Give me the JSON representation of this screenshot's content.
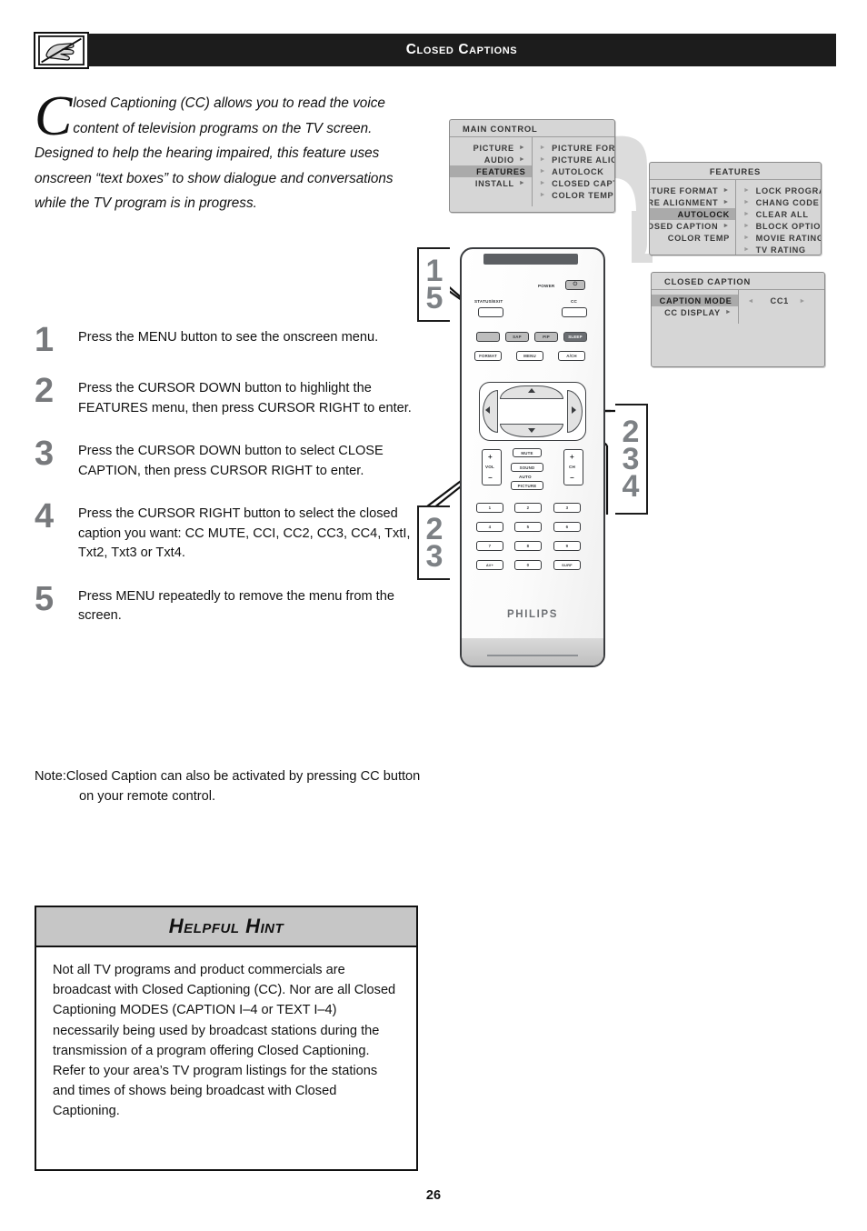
{
  "header": {
    "title": "Closed Captions",
    "icon": "hand-pointing-tv-crossed-icon"
  },
  "intro": {
    "dropcap": "C",
    "text": "losed Captioning (CC) allows you to read the voice content of television programs on the TV screen. Designed to help the hearing impaired, this feature uses onscreen “text boxes” to show dialogue and conversations while the TV program is in progress."
  },
  "steps": [
    {
      "num": "1",
      "text": "Press the MENU button to see the onscreen menu."
    },
    {
      "num": "2",
      "text": "Press the CURSOR DOWN button to highlight the FEATURES menu, then press CURSOR RIGHT to enter."
    },
    {
      "num": "3",
      "text": "Press the CURSOR DOWN button to select CLOSE CAPTION, then press CURSOR RIGHT to enter."
    },
    {
      "num": "4",
      "text": "Press the CURSOR RIGHT button to select the closed caption you want: CC MUTE, CCI, CC2, CC3, CC4, TxtI, Txt2, Txt3 or Txt4."
    },
    {
      "num": "5",
      "text": "Press MENU repeatedly to remove the menu from the screen."
    }
  ],
  "note": {
    "label": "Note:",
    "text": "Closed Caption can also be activated by pressing CC button on your remote control."
  },
  "hint": {
    "title": "Helpful Hint",
    "body": "Not all TV programs and product commercials are broadcast with Closed Captioning (CC). Nor are all Closed Captioning MODES (CAPTION I–4 or TEXT I–4) necessarily being used by broadcast stations during the transmission of a program offering Closed Captioning. Refer to your area’s TV program listings for the stations and times of shows being broadcast with Closed Captioning."
  },
  "page_number": "26",
  "osd": {
    "main_control": {
      "title": "MAIN CONTROL",
      "left_items": [
        {
          "label": "PICTURE",
          "arrow": true,
          "selected": false
        },
        {
          "label": "AUDIO",
          "arrow": true,
          "selected": false
        },
        {
          "label": "FEATURES",
          "arrow": false,
          "selected": true
        },
        {
          "label": "INSTALL",
          "arrow": true,
          "selected": false
        }
      ],
      "right_items": [
        "PICTURE FORMAT",
        "PICTURE ALIGNMENT",
        "AUTOLOCK",
        "CLOSED CAPTION",
        "COLOR TEMP"
      ]
    },
    "features": {
      "title": "FEATURES",
      "left_items": [
        {
          "label": "PICTURE FORMAT",
          "arrow": true,
          "selected": false
        },
        {
          "label": "PICTURE ALIGNMENT",
          "arrow": true,
          "selected": false
        },
        {
          "label": "AUTOLOCK",
          "arrow": false,
          "selected": true
        },
        {
          "label": "CLOSED CAPTION",
          "arrow": true,
          "selected": false
        },
        {
          "label": "COLOR TEMP",
          "arrow": false,
          "selected": false
        }
      ],
      "right_items": [
        "LOCK PROGRAM",
        "CHANG CODE",
        "CLEAR ALL",
        "BLOCK OPTION",
        "MOVIE RATING",
        "TV RATING"
      ]
    },
    "closed_caption": {
      "title": "CLOSED CAPTION",
      "left_items": [
        {
          "label": "CAPTION MODE",
          "arrow": false,
          "selected": true
        },
        {
          "label": "CC DISPLAY",
          "arrow": true,
          "selected": false
        }
      ],
      "value": "CC1",
      "left_arrow": "◄",
      "right_arrow": "►"
    }
  },
  "remote": {
    "brand": "PHILIPS",
    "labels": {
      "power": "POWER",
      "status_exit": "STATUS/EXIT",
      "cc": "CC",
      "vol": "VOL",
      "ch": "CH",
      "auto": "AUTO"
    },
    "buttons": {
      "power": "⏻",
      "sap": "SAP",
      "pip": "PIP",
      "sleep": "SLEEP",
      "format": "FORMAT",
      "menu": "MENU",
      "aadd": "A/CH",
      "mute": "MUTE",
      "sound": "SOUND",
      "picture": "PICTURE",
      "plus": "+",
      "minus": "−"
    },
    "keypad": [
      "1",
      "2",
      "3",
      "4",
      "5",
      "6",
      "7",
      "8",
      "9",
      "AV+",
      "0",
      "SURF"
    ]
  },
  "callouts": {
    "top_left": [
      "1",
      "5"
    ],
    "right": [
      "2",
      "3",
      "4"
    ],
    "bottom_left": [
      "2",
      "3"
    ]
  }
}
